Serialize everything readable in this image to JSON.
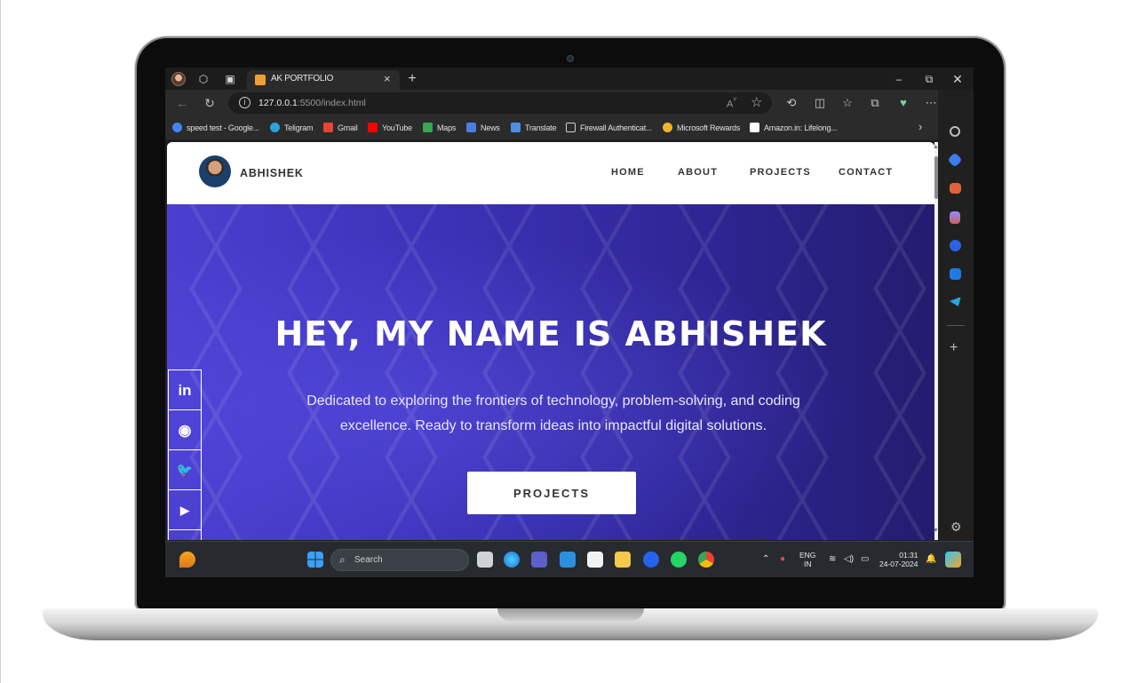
{
  "browser": {
    "tab_title": "AK PORTFOLIO",
    "tab_close": "×",
    "new_tab": "+",
    "url_host": "127.0.0.1",
    "url_rest": ":5500/index.html",
    "window_controls": {
      "minimize": "–",
      "restore": "⧉",
      "close": "✕"
    }
  },
  "bookmarks": [
    {
      "label": "speed test - Google...",
      "icon": "google-icon",
      "color": "#4285f4"
    },
    {
      "label": "Teligram",
      "icon": "telegram-icon",
      "color": "#2aa3dd"
    },
    {
      "label": "Gmail",
      "icon": "gmail-icon",
      "color": "#ea4335"
    },
    {
      "label": "YouTube",
      "icon": "youtube-icon",
      "color": "#ff0000"
    },
    {
      "label": "Maps",
      "icon": "maps-icon",
      "color": "#34a853"
    },
    {
      "label": "News",
      "icon": "news-icon",
      "color": "#4a7ee0"
    },
    {
      "label": "Translate",
      "icon": "translate-icon",
      "color": "#4a90e2"
    },
    {
      "label": "Firewall Authenticat...",
      "icon": "document-icon",
      "color": "#cfcfcf"
    },
    {
      "label": "Microsoft Rewards",
      "icon": "medal-icon",
      "color": "#f0b429"
    },
    {
      "label": "Amazon.in: Lifelong...",
      "icon": "amazon-icon",
      "color": "#ffffff"
    }
  ],
  "site": {
    "logo_text": "ABHISHEK",
    "nav": [
      "HOME",
      "ABOUT",
      "PROJECTS",
      "CONTACT"
    ],
    "hero_title": "HEY, MY NAME IS ABHISHEK",
    "hero_subtitle": "Dedicated to exploring the frontiers of technology, problem-solving, and coding excellence. Ready to transform ideas into impactful digital solutions.",
    "cta_label": "PROJECTS",
    "social": [
      {
        "name": "linkedin-icon",
        "glyph": "in"
      },
      {
        "name": "github-icon",
        "glyph": "◉"
      },
      {
        "name": "twitter-icon",
        "glyph": "🐦"
      },
      {
        "name": "youtube-icon",
        "glyph": "▶"
      },
      {
        "name": "instagram-icon",
        "glyph": "◎"
      }
    ]
  },
  "taskbar": {
    "search_placeholder": "Search",
    "lang_top": "ENG",
    "lang_bottom": "IN",
    "time": "01:31",
    "date": "24-07-2024"
  },
  "colors": {
    "hero_start": "#4b3fd0",
    "hero_end": "#231c6e",
    "browser_dark": "#2b2b2b"
  }
}
